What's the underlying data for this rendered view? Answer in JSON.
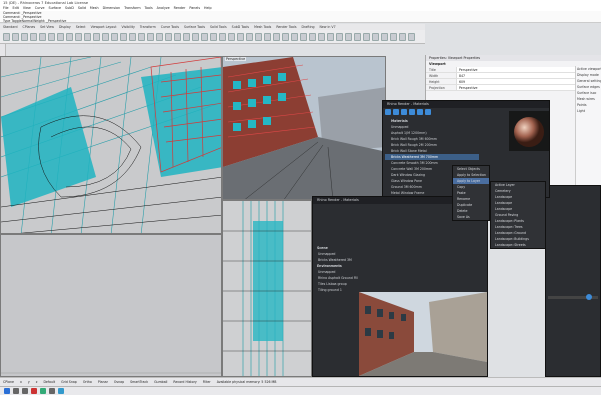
{
  "window": {
    "title": "15 (DE) - Rhinoceros 7 Educational Lab License"
  },
  "menu": [
    "File",
    "Edit",
    "View",
    "Curve",
    "Surface",
    "SubD",
    "Solid",
    "Mesh",
    "Dimension",
    "Transform",
    "Tools",
    "Analyze",
    "Render",
    "Panels",
    "Help"
  ],
  "command_lines": [
    "Command: _Perspective",
    "Command: _Perspective",
    "Type ToggleNormalWeight: _Perspective"
  ],
  "tabs": [
    "Standard",
    "CPlanes",
    "Set View",
    "Display",
    "Select",
    "Viewport Layout",
    "Visibility",
    "Transform",
    "Curve Tools",
    "Surface Tools",
    "Solid Tools",
    "SubD Tools",
    "Mesh Tools",
    "Render Tools",
    "Drafting",
    "New in V7"
  ],
  "viewports": {
    "top_left_label": "",
    "top_right_label": "Perspective",
    "bottom_right_label": ""
  },
  "properties": {
    "header": "Properties: Viewport Properties",
    "section": "Viewport",
    "rows": [
      {
        "k": "Title",
        "v": "Perspective"
      },
      {
        "k": "Width",
        "v": "847"
      },
      {
        "k": "Height",
        "v": "609"
      },
      {
        "k": "Projection",
        "v": "Perspective"
      }
    ],
    "right_items": [
      "Active viewport",
      "Display mode",
      "General settings",
      "Surface edges",
      "Surface isoc",
      "Mesh wires",
      "Points",
      "Light"
    ]
  },
  "materials": {
    "title": "Rhino Render - Materials",
    "items": [
      "Materials",
      "Unmapped",
      "Asphalt 1(M 1200mm)",
      "Brick Wall Rough 3M 600mm",
      "Brick Wall Rough 2M 200mm",
      "Brick Wall Stone Metal",
      "Bricks Weathered 3M 700mm",
      "Concrete Smooth 3M 200mm",
      "Concrete Wall 3M 200mm",
      "Dark Window Glazing",
      "Glass Window Pane",
      "Ground 3M 600mm",
      "Metal Window Frame",
      "Green Grass Wet",
      "Ground 3M 600mm",
      "Metal Structure 3M"
    ],
    "selected_index": 6,
    "scene_header": "Scene",
    "scene_items": [
      "Unmapped",
      "Bricks Weathered 3M"
    ],
    "env_header": "Environments",
    "env_items": [
      "Unmapped",
      "Rhino Asphalt Ground Fill",
      "Tiles Lisboa group",
      "Tiling ground 1"
    ]
  },
  "context_menu": {
    "items": [
      "Select Objects",
      "Apply to Selection",
      "Apply to Layer",
      "Copy",
      "Paste",
      "Rename",
      "Duplicate",
      "Delete",
      "Save As"
    ],
    "sub_items": [
      "Active Layer",
      "Cemetery",
      "Landscape",
      "Landscape",
      "Landscape",
      "Ground Paving",
      "Landscape::Plants",
      "Landscape::Trees",
      "Landscape::Ground",
      "Landscape::Buildings",
      "Landscape::Streets"
    ]
  },
  "status": {
    "items": [
      "CPlane",
      "x",
      "y",
      "z",
      "Default",
      "Grid Snap",
      "Ortho",
      "Planar",
      "Osnap",
      "SmartTrack",
      "Gumball",
      "Record History",
      "Filter",
      "Available physical memory: 5 526 MB"
    ]
  }
}
